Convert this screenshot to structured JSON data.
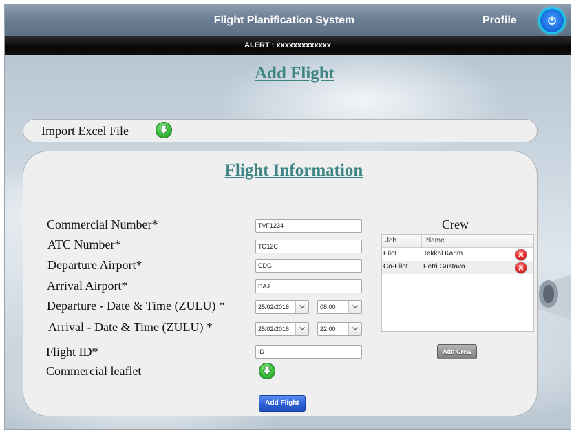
{
  "header": {
    "title": "Flight Planification System",
    "profile_label": "Profile",
    "power_icon": "power-icon"
  },
  "alert": {
    "text": "ALERT : xxxxxxxxxxxxx"
  },
  "page": {
    "title": "Add Flight"
  },
  "import": {
    "label": "Import Excel File",
    "icon": "download-icon"
  },
  "flight_info": {
    "title": "Flight Information",
    "fields": {
      "commercial_number": {
        "label": "Commercial Number*",
        "value": "TVF1234"
      },
      "atc_number": {
        "label": "ATC Number*",
        "value": "TO12C"
      },
      "departure_airport": {
        "label": "Departure Airport*",
        "value": "CDG"
      },
      "arrival_airport": {
        "label": "Arrival Airport*",
        "value": "DAJ"
      },
      "departure_datetime": {
        "label": "Departure - Date & Time (ZULU) *",
        "date": "25/02/2016",
        "time": "08:00"
      },
      "arrival_datetime": {
        "label": "Arrival - Date & Time (ZULU) *",
        "date": "25/02/2016",
        "time": "22:00"
      },
      "flight_id": {
        "label": "Flight ID*",
        "value": "ID"
      },
      "commercial_leaflet": {
        "label": "Commercial leaflet",
        "icon": "download-icon"
      }
    },
    "add_flight_label": "Add Flight"
  },
  "crew": {
    "title": "Crew",
    "columns": [
      "Job",
      "Name"
    ],
    "rows": [
      {
        "job": "Pilot",
        "name": "Tekkal Karim"
      },
      {
        "job": "Co-Pilot",
        "name": "Petri Gustavo"
      }
    ],
    "add_label": "Add Crew"
  },
  "colors": {
    "heading_teal": "#3f8585",
    "header_gray": "#6d7f94",
    "alert_black": "#050505",
    "power_cyan": "#16c6ec",
    "add_blue": "#2c5fd4"
  }
}
